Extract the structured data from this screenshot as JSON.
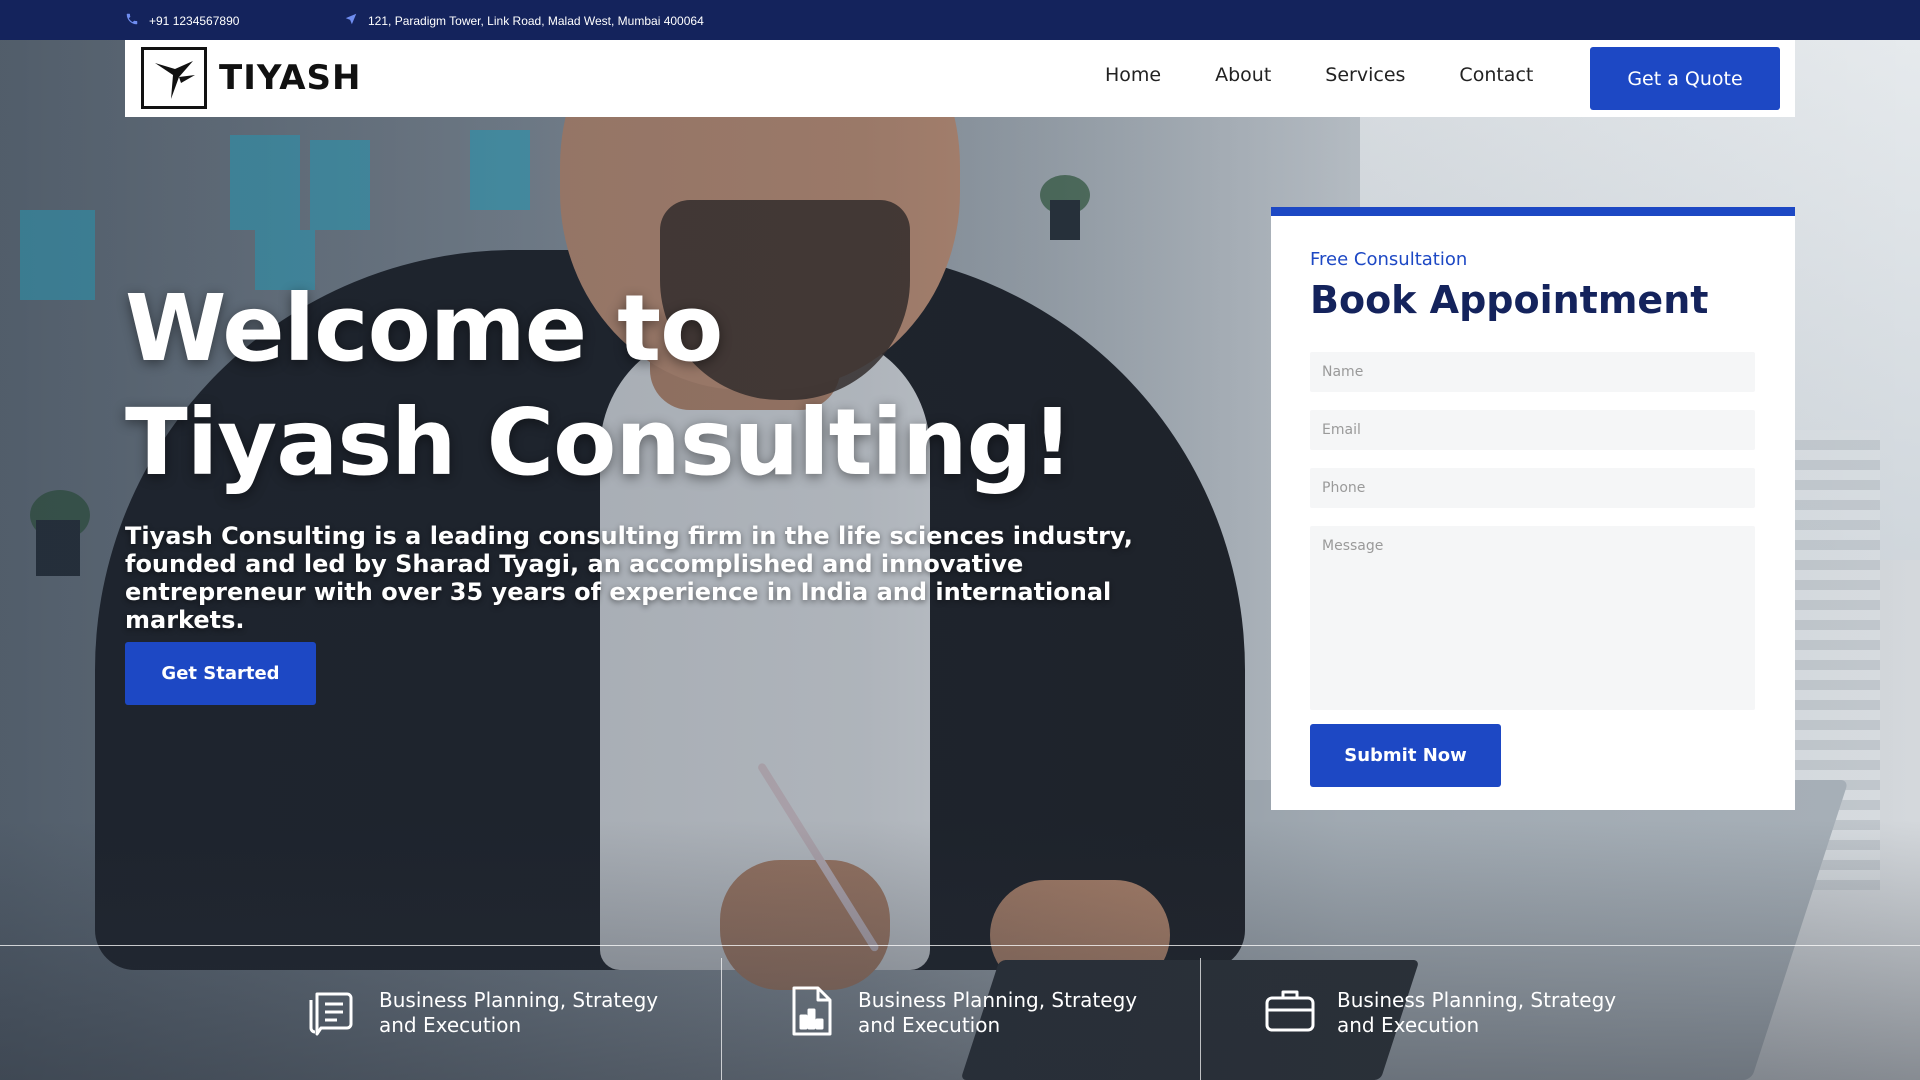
{
  "topbar": {
    "phone": "+91 1234567890",
    "address": "121, Paradigm Tower, Link Road, Malad West, Mumbai 400064",
    "background_color": "#14235c"
  },
  "header": {
    "logo_text": "TIYASH",
    "nav": [
      {
        "label": "Home"
      },
      {
        "label": "About"
      },
      {
        "label": "Services"
      },
      {
        "label": "Contact"
      }
    ],
    "cta_label": "Get a Quote"
  },
  "hero": {
    "title_line1": "Welcome to",
    "title_line2": "Tiyash Consulting!",
    "description": "Tiyash Consulting is a leading consulting firm in the life sciences industry, founded and led by Sharad Tyagi, an accomplished and innovative entrepreneur with over 35 years of experience in India and international markets.",
    "cta_label": "Get Started"
  },
  "appointment": {
    "kicker": "Free Consultation",
    "title": "Book Appointment",
    "fields": {
      "name_placeholder": "Name",
      "email_placeholder": "Email",
      "phone_placeholder": "Phone",
      "message_placeholder": "Message"
    },
    "submit_label": "Submit Now"
  },
  "features": [
    {
      "icon": "document-list-icon",
      "label": "Business Planning, Strategy and Execution"
    },
    {
      "icon": "chart-document-icon",
      "label": "Business Planning, Strategy and Execution"
    },
    {
      "icon": "briefcase-icon",
      "label": "Business Planning, Strategy and Execution"
    }
  ],
  "colors": {
    "accent": "#1d48c4",
    "navy": "#14235c"
  }
}
